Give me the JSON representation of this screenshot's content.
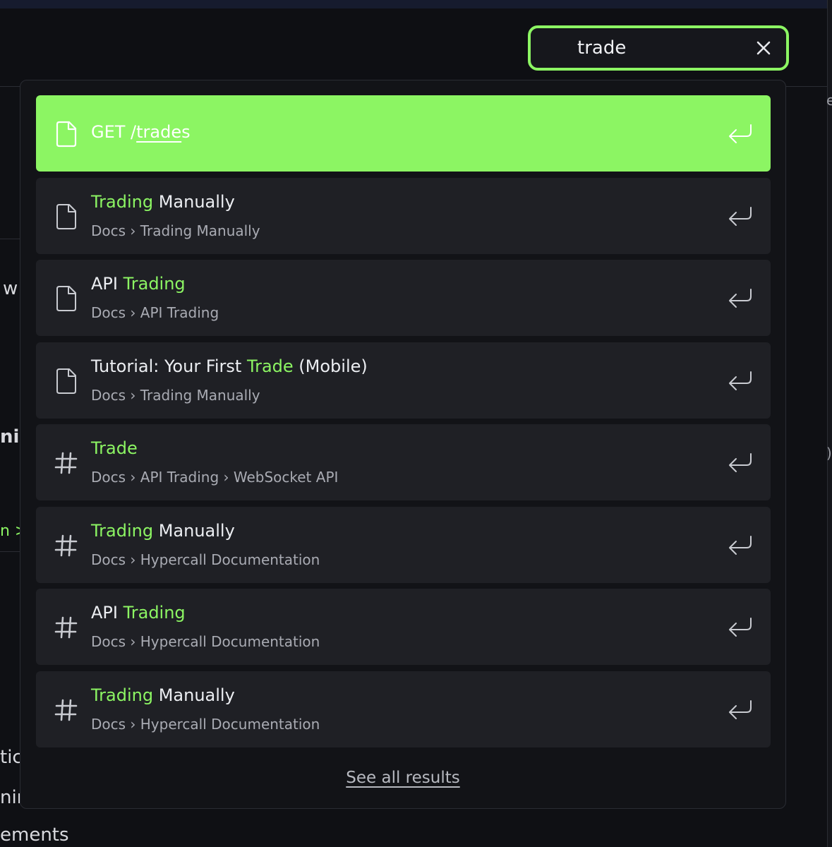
{
  "search": {
    "value": "trade"
  },
  "background": {
    "left_fragments": [
      "w",
      "nir",
      "tic",
      "nir",
      "ements"
    ],
    "green_fragment": "n >",
    "right_fragments": [
      "e",
      ")"
    ]
  },
  "results": [
    {
      "type": "page",
      "title_prefix": "GET /",
      "title_underlined": "trade",
      "title_suffix": "s",
      "active": true
    },
    {
      "type": "page",
      "title_hl": "Trading",
      "title_rest": " Manually",
      "path": "Docs › Trading Manually"
    },
    {
      "type": "page",
      "title_pre": "API ",
      "title_hl": "Trading",
      "path": "Docs › API Trading"
    },
    {
      "type": "page",
      "title_pre": "Tutorial: Your First ",
      "title_hl": "Trade",
      "title_rest": " (Mobile)",
      "path": "Docs › Trading Manually"
    },
    {
      "type": "section",
      "title_hl": "Trade",
      "path": "Docs › API Trading › WebSocket API"
    },
    {
      "type": "section",
      "title_hl": "Trading",
      "title_rest": " Manually",
      "path": "Docs › Hypercall Documentation"
    },
    {
      "type": "section",
      "title_pre": "API ",
      "title_hl": "Trading",
      "path": "Docs › Hypercall Documentation"
    },
    {
      "type": "section",
      "title_hl": "Trading",
      "title_rest": " Manually",
      "path": "Docs › Hypercall Documentation"
    }
  ],
  "see_all_label": "See all results",
  "icons": {
    "page": "document-icon",
    "section": "hash-icon",
    "enter": "enter-key-icon",
    "clear": "close-icon"
  },
  "colors": {
    "accent": "#8cf563",
    "panel": "#121317",
    "item": "#1f2025"
  }
}
